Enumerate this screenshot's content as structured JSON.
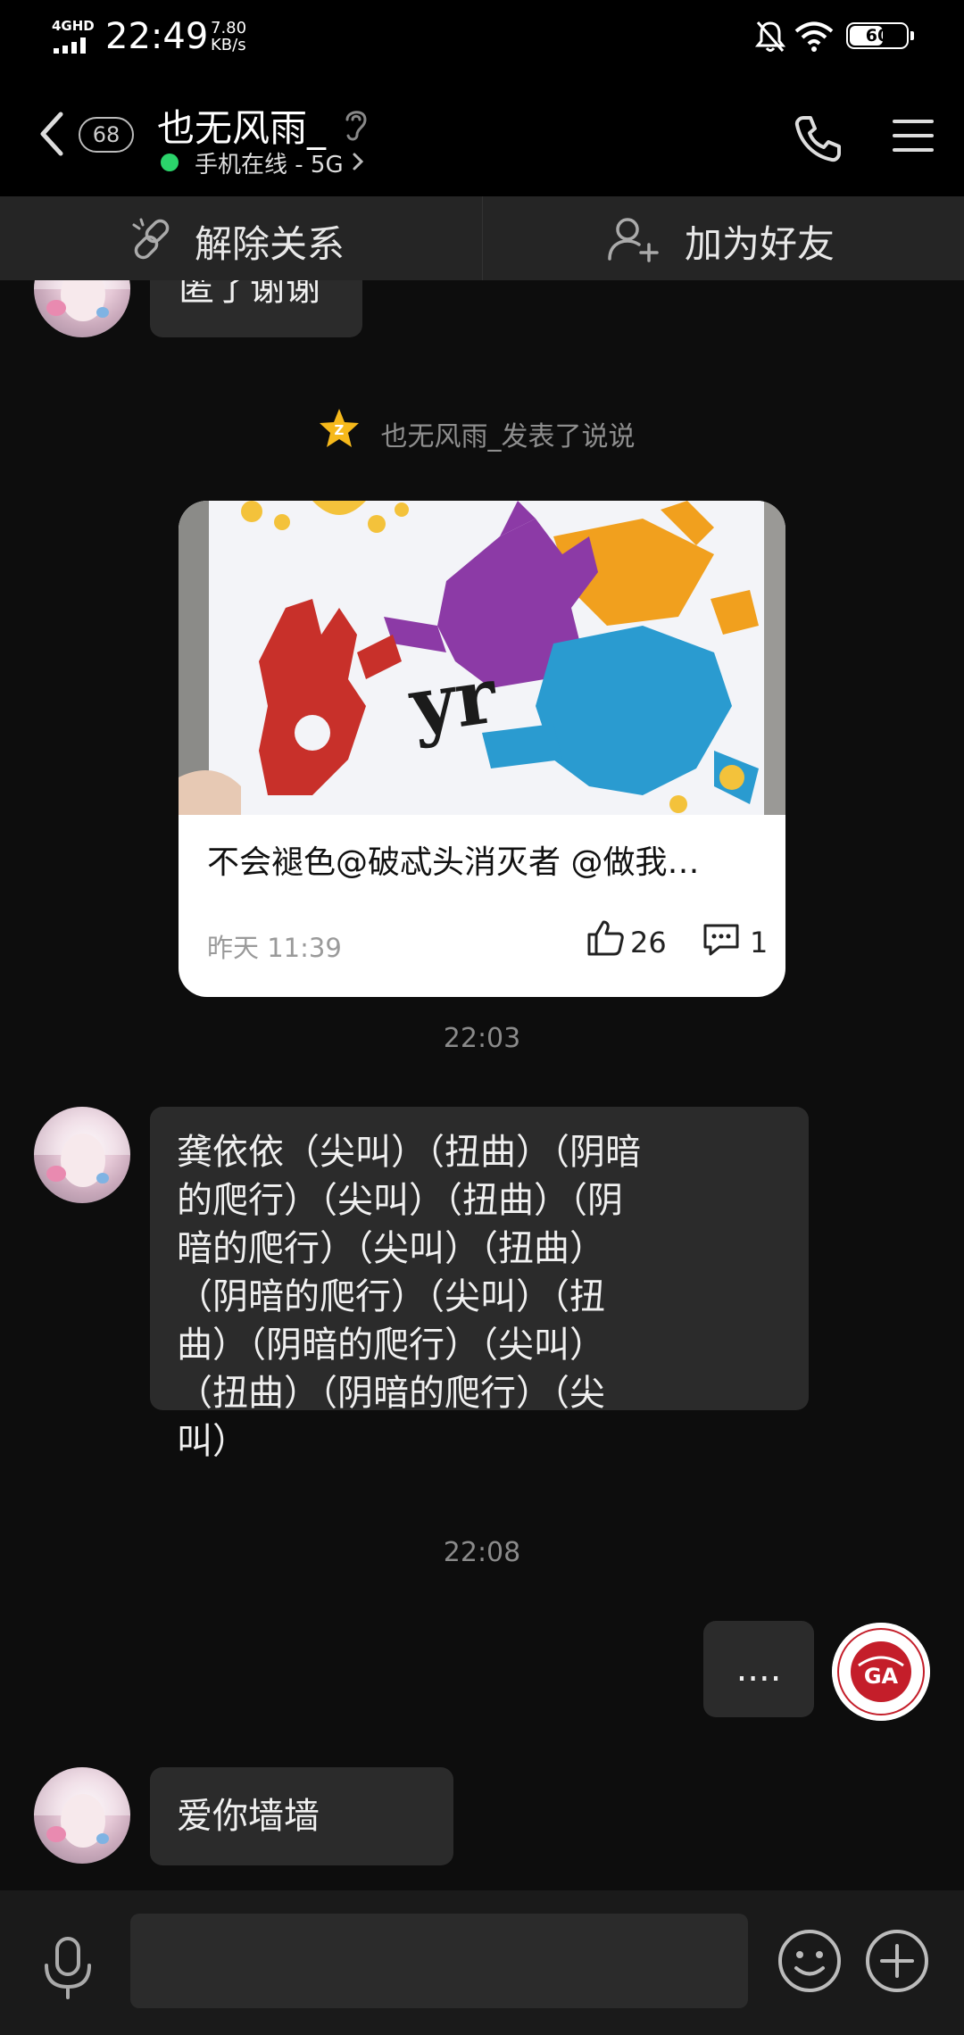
{
  "status_bar": {
    "network": "4GHD",
    "time": "22:49",
    "speed_value": "7.80",
    "speed_unit": "KB/s",
    "battery": "60",
    "battery_fraction": 0.6,
    "icons": [
      "signal-icon",
      "mute-icon",
      "wifi-icon",
      "battery-icon"
    ]
  },
  "header": {
    "unread_count": "68",
    "title": "也无风雨_",
    "status": "手机在线 - 5G",
    "icons": [
      "back-icon",
      "ear-icon",
      "phone-icon",
      "menu-icon"
    ]
  },
  "actions": {
    "unlink_label": "解除关系",
    "add_friend_label": "加为好友",
    "icons": [
      "unlink-icon",
      "add-friend-icon"
    ]
  },
  "messages": {
    "partial_text": "匿了谢谢",
    "system_note": "也无风雨_发表了说说",
    "feed": {
      "caption": "不会褪色@破忒头消灭者 @做我…",
      "time": "昨天 11:39",
      "likes": "26",
      "comments": "1",
      "image_text": "yr"
    },
    "time_1": "22:03",
    "long_text": "龚依依（尖叫）（扭曲）（阴暗的爬行）（尖叫）（扭曲）（阴暗的爬行）（尖叫）（扭曲）（阴暗的爬行）（尖叫）（扭曲）（阴暗的爬行）（尖叫）（扭曲）（阴暗的爬行）（尖叫）",
    "long_text_lines": [
      "龚依依（尖叫）（扭曲）（阴暗",
      "的爬行）（尖叫）（扭曲）（阴",
      "暗的爬行）（尖叫）（扭曲）",
      "（阴暗的爬行）（尖叫）（扭",
      "曲）（阴暗的爬行）（尖叫）",
      "（扭曲）（阴暗的爬行）（尖",
      "叫）"
    ],
    "time_2": "22:08",
    "my_message": "....",
    "last_text": "爱你墙墙",
    "last_emojis": "😚😚",
    "my_avatar_text": "GA"
  },
  "input": {
    "placeholder": "",
    "icons": [
      "mic-icon",
      "emoji-icon",
      "plus-icon"
    ]
  },
  "colors": {
    "background": "#0d0d0d",
    "bubble": "#2b2b2b",
    "online": "#2bd46b",
    "card": "#ffffff",
    "badge_red": "#c41e2a"
  }
}
